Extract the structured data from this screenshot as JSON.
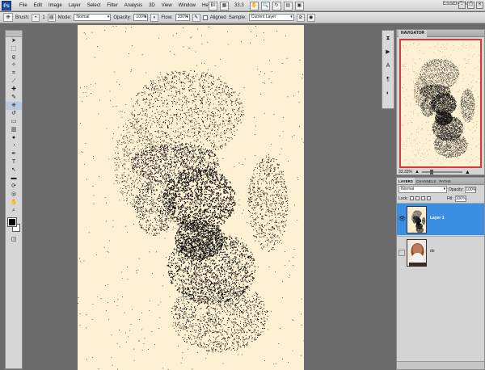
{
  "app": {
    "logo": "Ps",
    "workspace": "ESSENTIALS"
  },
  "menu": [
    "File",
    "Edit",
    "Image",
    "Layer",
    "Select",
    "Filter",
    "Analysis",
    "3D",
    "View",
    "Window",
    "Help"
  ],
  "menubar_zoom": "33.3",
  "window_buttons": [
    "-",
    "□",
    "×"
  ],
  "options": {
    "brush_label": "Brush:",
    "brush_size": "1",
    "mode_label": "Mode:",
    "mode_value": "Normal",
    "opacity_label": "Opacity:",
    "opacity_value": "100%",
    "flow_label": "Flow:",
    "flow_value": "100%",
    "aligned_label": "Aligned",
    "sample_label": "Sample:",
    "sample_value": "Current Layer"
  },
  "navigator": {
    "tab": "NAVIGATOR",
    "zoom": "33.33%"
  },
  "layers": {
    "tabs": [
      "LAYERS",
      "CHANNELS",
      "PATHS"
    ],
    "blend_mode": "Normal",
    "opacity_label": "Opacity:",
    "opacity_value": "100%",
    "lock_label": "Lock:",
    "fill_label": "Fill:",
    "fill_value": "100%",
    "items": [
      {
        "name": "Layer 1",
        "selected": true,
        "visible": true
      },
      {
        "name": "do",
        "selected": false,
        "visible": false
      }
    ]
  },
  "icons": {
    "tools": [
      "move-icon",
      "marquee-icon",
      "lasso-icon",
      "quick-select-icon",
      "crop-icon",
      "eyedropper-icon",
      "healing-icon",
      "brush-icon",
      "clone-stamp-icon",
      "history-brush-icon",
      "eraser-icon",
      "gradient-icon",
      "blur-icon",
      "dodge-icon",
      "pen-icon",
      "type-icon",
      "path-select-icon",
      "shape-icon",
      "3d-rotate-icon",
      "3d-orbit-icon",
      "hand-icon",
      "zoom-icon"
    ],
    "colors": {
      "foreground": "#000000",
      "background": "#ffffff",
      "canvas": "#fdf0d3",
      "selection": "#3a8fe3"
    }
  }
}
